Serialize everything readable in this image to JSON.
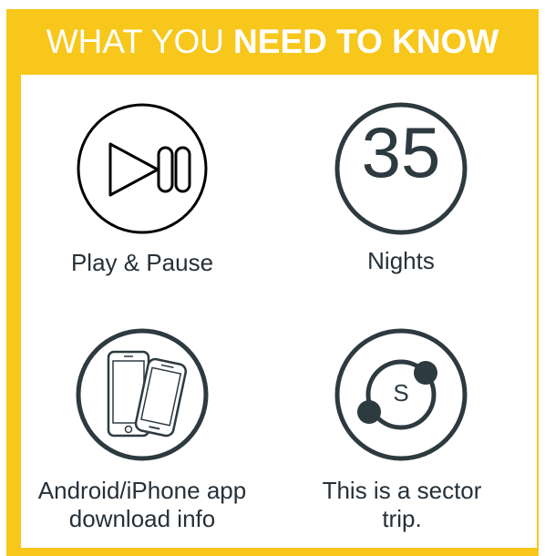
{
  "header": {
    "title_light": "WHAT YOU",
    "title_bold": "NEED TO KNOW"
  },
  "items": [
    {
      "icon": "play-pause-icon",
      "label": "Play & Pause"
    },
    {
      "icon": "nights-counter-icon",
      "number": "35",
      "label": "Nights"
    },
    {
      "icon": "phones-icon",
      "label": "Android/iPhone app download info"
    },
    {
      "icon": "sector-trip-icon",
      "letter": "S",
      "label": "This is a sector trip."
    }
  ],
  "colors": {
    "accent_yellow": "#f8c71b",
    "icon_dark": "#2d3a40",
    "header_text": "#ffffff"
  }
}
